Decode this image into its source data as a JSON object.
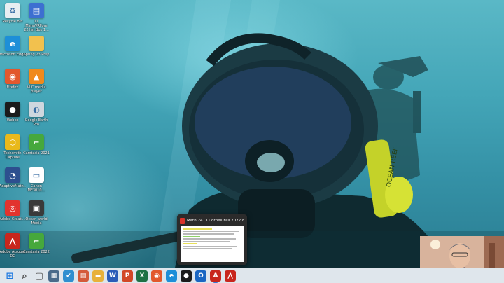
{
  "desktop": {
    "icons": [
      {
        "label": "Recycle Bin",
        "icon": "recycle-bin-icon",
        "color": "#e8eef2",
        "glyph": "♻"
      },
      {
        "label": "11 ManaVRFore 22 list Box 1...",
        "icon": "document-icon",
        "color": "#3d6fd1",
        "glyph": "▤"
      },
      {
        "label": "Microsoft Edge",
        "icon": "edge-icon",
        "color": "#1d8fd8",
        "glyph": "e"
      },
      {
        "label": "Spring 23 Prep",
        "icon": "folder-icon",
        "color": "#f2c14e",
        "glyph": ""
      },
      {
        "label": "Firefox",
        "icon": "firefox-icon",
        "color": "#e2582d",
        "glyph": "◉"
      },
      {
        "label": "VLC media player",
        "icon": "vlc-icon",
        "color": "#f08a1c",
        "glyph": "▲"
      },
      {
        "label": "Webex",
        "icon": "webex-icon",
        "color": "#1b1b1b",
        "glyph": "●"
      },
      {
        "label": "Google Earth Pro",
        "icon": "google-earth-icon",
        "color": "#cfd7de",
        "glyph": "◐"
      },
      {
        "label": "Techsmith Capture",
        "icon": "techsmith-capture-icon",
        "color": "#e9b91b",
        "glyph": "⬡"
      },
      {
        "label": "Camtasia 2021",
        "icon": "camtasia-icon",
        "color": "#46a83c",
        "glyph": "⌐"
      },
      {
        "label": "AdaptiveMath...",
        "icon": "app-icon",
        "color": "#2d4f8f",
        "glyph": "◔"
      },
      {
        "label": "Canon MF3010...",
        "icon": "printer-icon",
        "color": "#ffffff",
        "glyph": "▭"
      },
      {
        "label": "Adobe Creati...",
        "icon": "adobe-cc-icon",
        "color": "#e2332e",
        "glyph": "◎"
      },
      {
        "label": "Ocean world Media",
        "icon": "media-icon",
        "color": "#3a3a3a",
        "glyph": "▣"
      },
      {
        "label": "Adobe Acrobat DC",
        "icon": "acrobat-icon",
        "color": "#c8261d",
        "glyph": "⋀"
      },
      {
        "label": "Camtasia 2022",
        "icon": "camtasia-2022-icon",
        "color": "#46a83c",
        "glyph": "⌐"
      }
    ]
  },
  "preview": {
    "title": "Math 2413 Corbell Fall 2022 8.7....",
    "icon": "pdf-icon"
  },
  "wallpaper": {
    "mask_label": "OCEAN REEF"
  },
  "taskbar": {
    "items": [
      {
        "name": "start-button",
        "icon": "windows-icon",
        "color": "#1f7ae0",
        "glyph": "⊞"
      },
      {
        "name": "search-button",
        "icon": "search-icon",
        "color": "#444",
        "glyph": "⌕"
      },
      {
        "name": "task-view-button",
        "icon": "task-view-icon",
        "color": "#555",
        "glyph": "▢"
      },
      {
        "name": "taskbar-app-1",
        "icon": "app-icon",
        "color": "#4a6a8a",
        "glyph": "▦"
      },
      {
        "name": "taskbar-app-2",
        "icon": "app-icon",
        "color": "#2f8fd0",
        "glyph": "✔"
      },
      {
        "name": "taskbar-app-3",
        "icon": "app-icon",
        "color": "#d45a3a",
        "glyph": "▤"
      },
      {
        "name": "file-explorer-button",
        "icon": "folder-icon",
        "color": "#e8b13a",
        "glyph": "▬"
      },
      {
        "name": "word-button",
        "icon": "word-icon",
        "color": "#2b5cb8",
        "glyph": "W"
      },
      {
        "name": "powerpoint-button",
        "icon": "powerpoint-icon",
        "color": "#d24726",
        "glyph": "P"
      },
      {
        "name": "excel-button",
        "icon": "excel-icon",
        "color": "#1e7145",
        "glyph": "X"
      },
      {
        "name": "firefox-button",
        "icon": "firefox-icon",
        "color": "#e2582d",
        "glyph": "◉"
      },
      {
        "name": "edge-button",
        "icon": "edge-icon",
        "color": "#1d8fd8",
        "glyph": "e"
      },
      {
        "name": "webex-button",
        "icon": "webex-icon",
        "color": "#1b1b1b",
        "glyph": "●"
      },
      {
        "name": "outlook-button",
        "icon": "outlook-icon",
        "color": "#1a66c2",
        "glyph": "O"
      },
      {
        "name": "acrobat-button-1",
        "icon": "acrobat-icon",
        "color": "#c8261d",
        "glyph": "A"
      },
      {
        "name": "acrobat-button-2",
        "icon": "acrobat-icon",
        "color": "#c8261d",
        "glyph": "⋀"
      }
    ]
  }
}
